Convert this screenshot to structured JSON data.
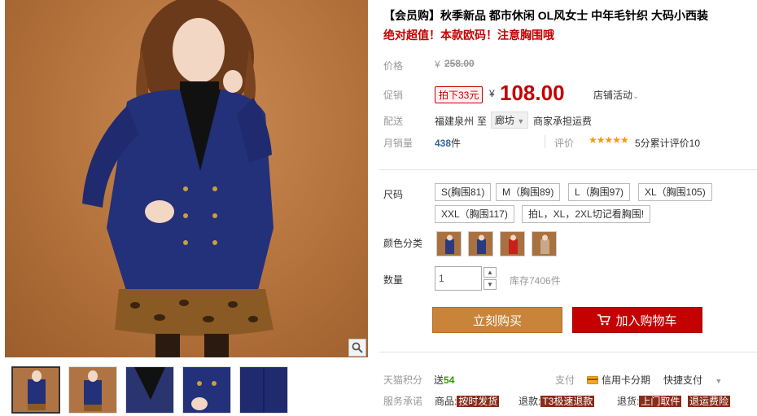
{
  "product": {
    "title": "【会员购】秋季新品 都市休闲 OL风女士 中年毛针织 大码小西装",
    "subtitle": "绝对超值！本款欧码！注意胸围哦"
  },
  "price": {
    "label": "价格",
    "currency": "¥",
    "original": "258.00"
  },
  "promo": {
    "label": "促销",
    "tag": "拍下33元",
    "currency": "¥",
    "price": "108.00",
    "store_activity": "店铺活动"
  },
  "shipping": {
    "label": "配送",
    "from": "福建泉州",
    "to_word": "至",
    "city": "廊坊",
    "note": "商家承担运费"
  },
  "sales": {
    "label": "月销量",
    "count": "438",
    "unit": "件",
    "review_label": "评价",
    "stars": "★★★★★",
    "review_text": "5分累计评价10"
  },
  "sizes": {
    "label": "尺码",
    "options": [
      "S(胸围81)",
      "M（胸围89)",
      "L（胸围97)",
      "XL（胸围105)",
      "XXL（胸围117)",
      "拍L，XL，2XL切记看胸围!"
    ]
  },
  "colors": {
    "label": "颜色分类",
    "swatch_colors": [
      "#2a3a80",
      "#2a3a80",
      "#c8201a",
      "#c8a888"
    ]
  },
  "quantity": {
    "label": "数量",
    "value": "1",
    "stock": "库存7406件"
  },
  "actions": {
    "buy": "立刻购买",
    "cart": "加入购物车"
  },
  "points": {
    "label": "天猫积分",
    "prefix": "送",
    "value": "54",
    "pay_label": "支付",
    "credit": "信用卡分期",
    "quickpay": "快捷支付"
  },
  "service": {
    "label": "服务承诺",
    "items": [
      {
        "prefix": "商品:",
        "badge": "按时发货"
      },
      {
        "prefix": "退款:",
        "badge": "T3极速退款"
      },
      {
        "prefix": "退货:",
        "badge": "上门取件"
      },
      {
        "prefix": "",
        "badge": "退运费险"
      }
    ]
  },
  "colors_theme": {
    "accent": "#c40000",
    "buy": "#c9843a"
  }
}
